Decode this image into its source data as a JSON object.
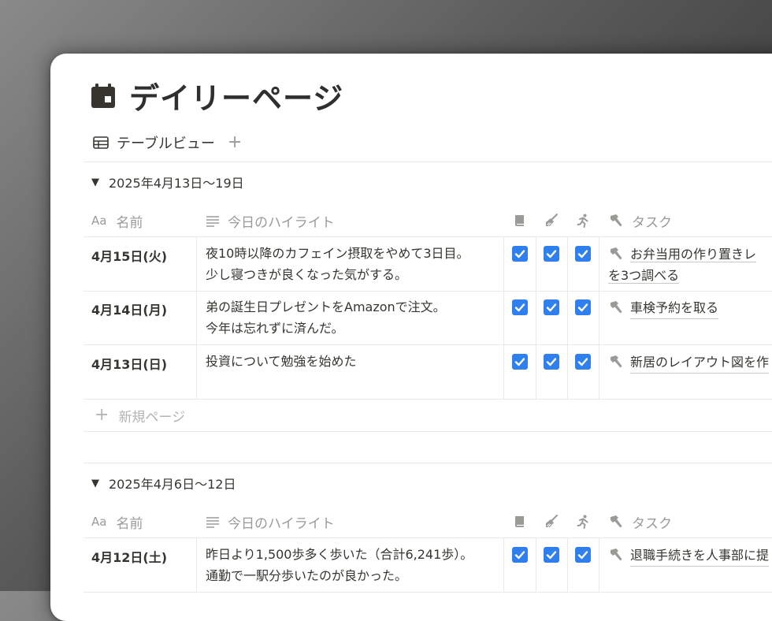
{
  "page": {
    "title": "デイリーページ",
    "icon": "calendar-icon"
  },
  "view": {
    "label": "テーブルビュー",
    "add_label": "+"
  },
  "columns": {
    "name": "名前",
    "name_icon_text": "Aa",
    "highlight": "今日のハイライト",
    "check1_icon": "book-icon",
    "check2_icon": "broom-icon",
    "check3_icon": "running-icon",
    "task": "タスク",
    "task_icon": "hammer-icon"
  },
  "groups": [
    {
      "label": "2025年4月13日～19日",
      "rows": [
        {
          "date": "4月15日(火)",
          "line1": "夜10時以降のカフェイン摂取をやめて3日目。",
          "line2": "少し寝つきが良くなった気がする。",
          "task1": "お弁当用の作り置きレ",
          "task2": "を3つ調べる",
          "checks": [
            true,
            true,
            true
          ]
        },
        {
          "date": "4月14日(月)",
          "line1": "弟の誕生日プレゼントをAmazonで注文。",
          "line2": "今年は忘れずに済んだ。",
          "task1": "車検予約を取る",
          "task2": "",
          "checks": [
            true,
            true,
            true
          ]
        },
        {
          "date": "4月13日(日)",
          "line1": "投資について勉強を始めた",
          "line2": "",
          "task1": "新居のレイアウト図を作",
          "task2": "",
          "checks": [
            true,
            true,
            true
          ]
        }
      ],
      "new_page": "新規ページ"
    },
    {
      "label": "2025年4月6日～12日",
      "rows": [
        {
          "date": "4月12日(土)",
          "line1": "昨日より1,500歩多く歩いた（合計6,241歩）。",
          "line2": "通勤で一駅分歩いたのが良かった。",
          "task1": "退職手続きを人事部に提",
          "task2": "",
          "checks": [
            true,
            true,
            true
          ]
        }
      ]
    }
  ],
  "colors": {
    "checkbox": "#2f80ed",
    "text": "#37352f",
    "muted": "#9b9a97",
    "border": "#e9e9e7"
  }
}
